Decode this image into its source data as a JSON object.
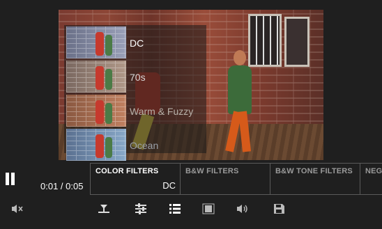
{
  "filters": {
    "items": [
      {
        "label": "DC"
      },
      {
        "label": "70s"
      },
      {
        "label": "Warm & Fuzzy"
      },
      {
        "label": "Ocean"
      }
    ]
  },
  "player": {
    "time": "0:01 / 0:05"
  },
  "tabs": [
    {
      "label": "COLOR FILTERS",
      "value": "DC"
    },
    {
      "label": "B&W FILTERS"
    },
    {
      "label": "B&W TONE FILTERS"
    },
    {
      "label": "NEGA"
    }
  ],
  "toolbar": {
    "icons": [
      "mute-icon",
      "trim-icon",
      "adjust-icon",
      "list-icon",
      "crop-icon",
      "volume-icon",
      "save-icon"
    ]
  },
  "colors": {
    "background": "#1f1f1f",
    "tab_border": "#5a5a5a",
    "inactive_tab": "#9a9a9a"
  }
}
